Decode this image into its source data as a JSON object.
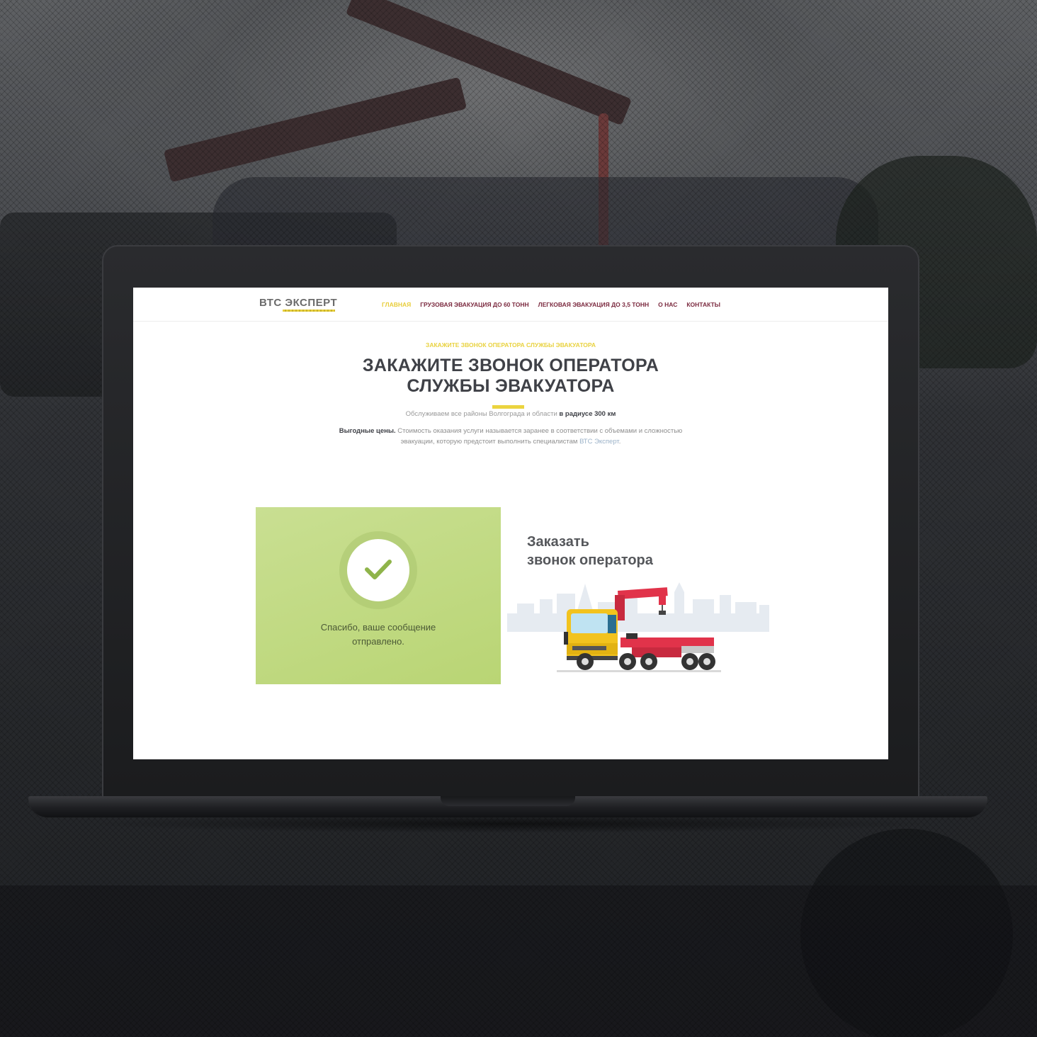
{
  "site": {
    "logo": "ВТС ЭКСПЕРТ",
    "nav": [
      {
        "label": "ГЛАВНАЯ",
        "active": true
      },
      {
        "label": "ГРУЗОВАЯ ЭВАКУАЦИЯ ДО 60 ТОНН",
        "active": false
      },
      {
        "label": "ЛЕГКОВАЯ ЭВАКУАЦИЯ ДО 3,5 ТОНН",
        "active": false
      },
      {
        "label": "О НАС",
        "active": false
      },
      {
        "label": "КОНТАКТЫ",
        "active": false
      }
    ]
  },
  "hero": {
    "kicker": "ЗАКАЖИТЕ ЗВОНОК ОПЕРАТОРА СЛУЖБЫ ЭВАКУАТОРА",
    "title_line1": "ЗАКАЖИТЕ ЗВОНОК ОПЕРАТОРА",
    "title_line2": "СЛУЖБЫ ЭВАКУАТОРА",
    "subline_text": "Обслуживаем все районы Волгограда и области ",
    "subline_bold": "в радиусе 300 км",
    "desc_bold": "Выгодные цены.",
    "desc_text": " Стоимость оказания услуги называется заранее в соответствии с объемами и сложностью эвакуации, которую предстоит выполнить специалистам ",
    "desc_brand": "ВТС Эксперт",
    "desc_end": "."
  },
  "form_result": {
    "icon": "check-icon",
    "message_line1": "Спасибо, ваше сообщение",
    "message_line2": "отправлено."
  },
  "order": {
    "title_line1": "Заказать",
    "title_line2": "звонок оператора"
  },
  "colors": {
    "accent_yellow": "#e8cd3a",
    "nav_link": "#7b2a3f",
    "success_green": "#bfd87e",
    "heading": "#3f4147"
  }
}
